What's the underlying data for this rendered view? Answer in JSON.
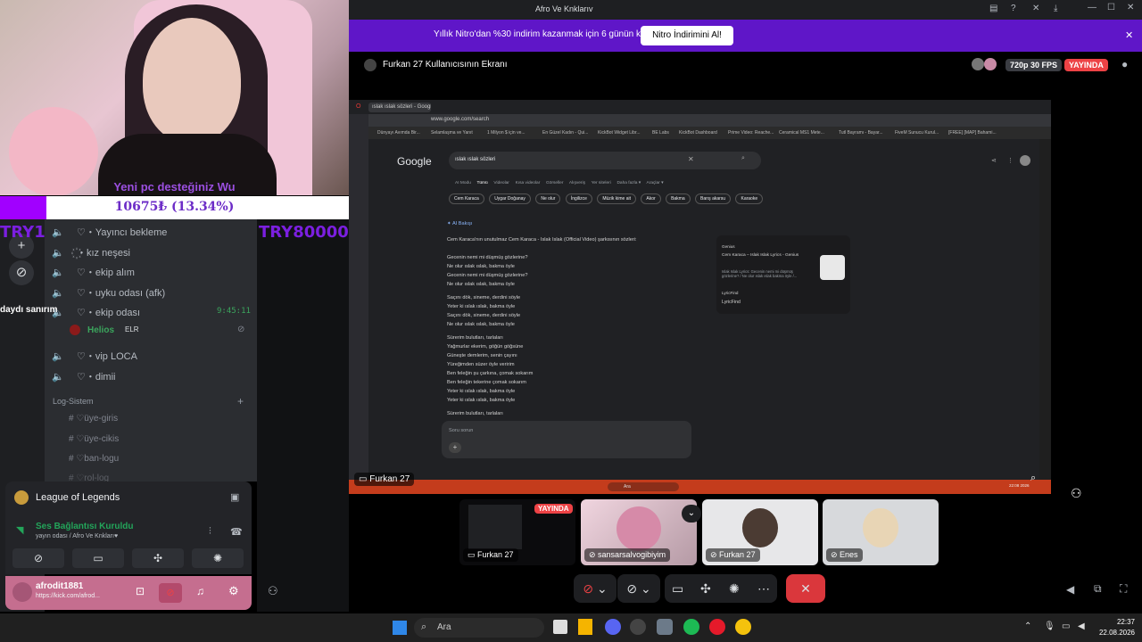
{
  "webcam": {
    "caption": "Yeni pc desteğiniz Wu"
  },
  "donation": {
    "text": "10675₺ (13.34%)",
    "progress_percent": 13.34
  },
  "overlay": {
    "left_code": "TRY1",
    "right_code": "TRY80000",
    "side_text": "daydı sanırım"
  },
  "rail": {
    "add_icon": "+",
    "explore_icon": "⊘"
  },
  "channels": [
    {
      "name": "♡・Yayıncı bekleme"
    },
    {
      "name": "꙰・kız neşesi"
    },
    {
      "name": "♡・ekip alım"
    },
    {
      "name": "♡・uyku odası (afk)"
    },
    {
      "name": "♡・ekip odası",
      "time": "9:45:11"
    },
    {
      "name": "♡・vip LOCA"
    },
    {
      "name": "♡・dimii"
    }
  ],
  "voice_member": {
    "name": "Helios",
    "tag": "ELR"
  },
  "category": {
    "name": "Log-Sistem",
    "add": "+"
  },
  "log_channels": [
    "♡üye-giris",
    "♡üye-cikis",
    "♡ban-logu",
    "♡rol-log"
  ],
  "activity": {
    "title": "League of Legends"
  },
  "voice": {
    "status": "Ses Bağlantısı Kuruldu",
    "room": "yayın odası / Afro Ve Knkları♥"
  },
  "user": {
    "name": "afrodit1881",
    "status": "https://kick.com/afrod..."
  },
  "window": {
    "title": "Afro Ve Knklarıv"
  },
  "nitro": {
    "text": "Yıllık Nitro'dan %30 indirim kazanmak için 6 günün kaldı",
    "button": "Nitro İndirimini Al!"
  },
  "stream": {
    "title": "Furkan 27 Kullanıcısının Ekranı",
    "quality": "720p 30 FPS",
    "live": "YAYINDA"
  },
  "shared": {
    "tab": "ıslak ıslak sözleri - Google",
    "url": "www.google.com/search",
    "bookmarks": [
      "Dünyayı Avımda Bir...",
      "Selamlaşma ve Yanıt",
      "1 Milyon $ için ve...",
      "En Güzel Kadın - Qui...",
      "KickBot Widget Libr...",
      "BE Labs",
      "KickBot Dashboard",
      "Prime Video: Reache...",
      "Ceramical MS1 Mete...",
      "Tutl Bayramı - Bayar...",
      "FiveM Sunucu Kurul...",
      "[FREE] [MAP] Bahami..."
    ],
    "google_logo": "Google",
    "query": "ıslak ıslak sözleri",
    "search_tabs": [
      "AI Modu",
      "Tümü",
      "Videolar",
      "Kısa videolar",
      "Görseller",
      "Alışveriş",
      "Yer siteleri",
      "Daha fazla ▾",
      "Araçlar ▾"
    ],
    "chips": [
      "Cem Karaca",
      "Uygar Doğanay",
      "Ne olur",
      "İngilizce",
      "Müzik kime ait",
      "Akor",
      "Bakma",
      "Barış akarsu",
      "Karaoke"
    ],
    "ai_header": "AI Bakışı",
    "ai_intro": "Cem Karaca'nın unutulmaz Cem Karaca - Islak Islak (Official Video) şarkısının sözleri:",
    "lyrics": [
      "Gecenin nemi mi düşmüş gözlerine?",
      "Ne olur ıslak ıslak, bakma öyle",
      "Gecenin nemi mi düşmüş gözlerine?",
      "Ne olur ıslak ıslak, bakma öyle",
      "",
      "Saçını dök, sineme, derdini söyle",
      "Yeter ki ıslak ıslak, bakma öyle",
      "Saçını dök, sineme, derdini söyle",
      "Ne olur ıslak ıslak, bakma öyle",
      "",
      "Sürerim bulutları, tarlaları",
      "Yağmurlar ekerim, göğün göğsüne",
      "Güneşte demlerim, senin çayını",
      "Yüreğimden süzer öyle veririm",
      "Ben feleğin şu çarkına, çomak sokarım",
      "Ben feleğin tekerine çomak sokarım",
      "Yeter ki ıslak ıslak, bakma öyle",
      "Yeter ki ıslak ıslak, bakma öyle",
      "",
      "Sürerim bulutları, tarlaları"
    ],
    "card": {
      "source": "Genius",
      "title": "Cem Karaca – Islak Islak Lyrics - Genius",
      "desc": "Islak Islak Lyrics: Gecenin nemi mi düşmüş gözlerine? / Ne olur ıslak ıslak bakma öyle /...",
      "source2": "LyricFind",
      "title2": "LyricFind"
    },
    "ask": "Soru sorun",
    "taskbar_search": "Ara",
    "clock": "22:08 2026"
  },
  "stream_label": "Furkan 27",
  "tiles": [
    {
      "name": "Furkan 27",
      "live": "YAYINDA"
    },
    {
      "name": "sansarsalvogibiyim"
    },
    {
      "name": "Furkan 27"
    },
    {
      "name": "Enes"
    }
  ],
  "os": {
    "search": "Ara",
    "time": "22:37",
    "date": "22.08.2026"
  },
  "colors": {
    "accent": "#5865f2",
    "live": "#ed4245",
    "nitro": "#5f16c8",
    "donation": "#a100ff"
  }
}
